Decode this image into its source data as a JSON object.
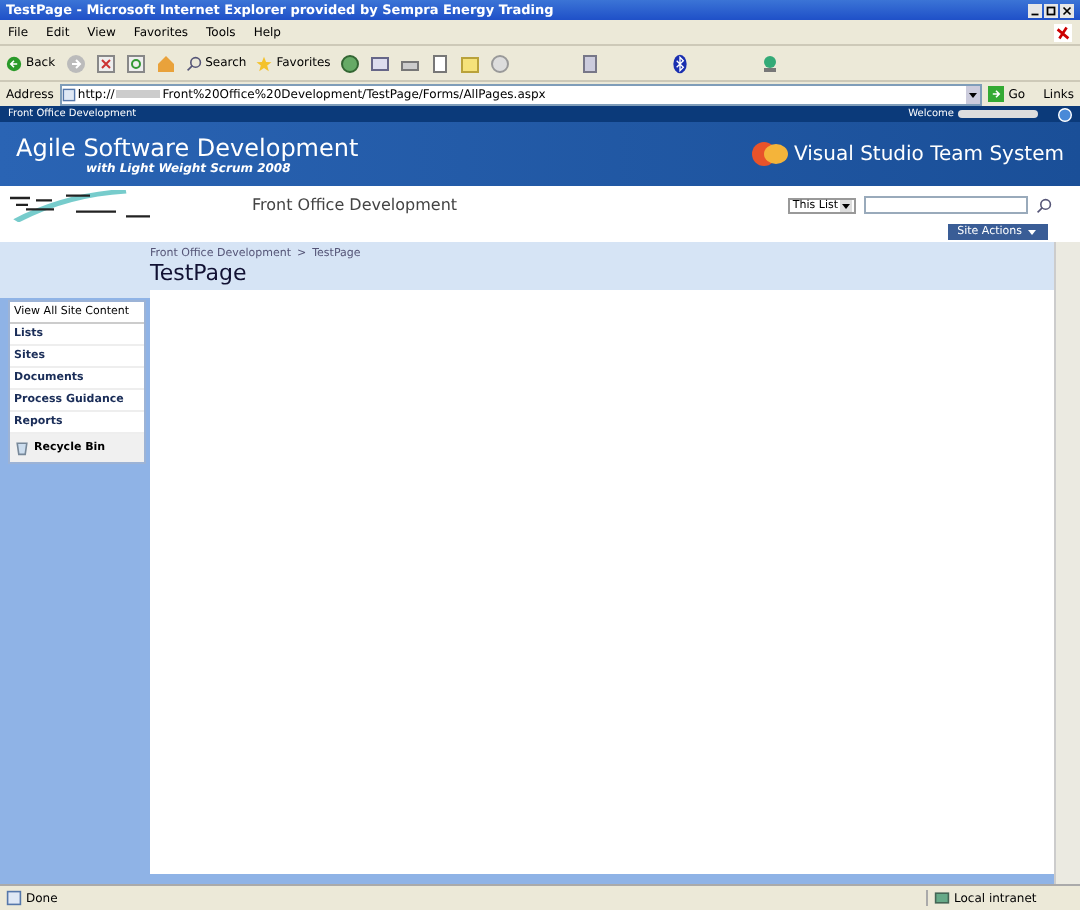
{
  "window": {
    "title": "TestPage - Microsoft Internet Explorer provided by Sempra Energy Trading"
  },
  "menu": [
    "File",
    "Edit",
    "View",
    "Favorites",
    "Tools",
    "Help"
  ],
  "toolbar": [
    {
      "kind": "back",
      "label": "Back"
    },
    {
      "kind": "search",
      "label": "Search"
    },
    {
      "kind": "favorites",
      "label": "Favorites"
    }
  ],
  "address": {
    "label": "Address",
    "url_start": "http://",
    "url_end": "Front%20Office%20Development/TestPage/Forms/AllPages.aspx",
    "go": "Go",
    "links": "Links"
  },
  "site": {
    "top_link": "Front Office Development",
    "welcome": "Welcome",
    "banner_title": "Agile Software Development",
    "banner_subtitle": "with Light Weight Scrum 2008",
    "product": "Visual Studio Team System",
    "site_title": "Front Office Development",
    "scope": "This List",
    "site_actions": "Site Actions"
  },
  "breadcrumb": [
    "Front Office Development",
    "TestPage"
  ],
  "breadcrumb_separator": ">",
  "page_title": "TestPage",
  "quick_launch": {
    "view_all": "View All Site Content",
    "items": [
      "Lists",
      "Sites",
      "Documents",
      "Process Guidance",
      "Reports"
    ],
    "recycle_bin": "Recycle Bin"
  },
  "status_bar": {
    "text": "Done",
    "zone": "Local intranet"
  }
}
